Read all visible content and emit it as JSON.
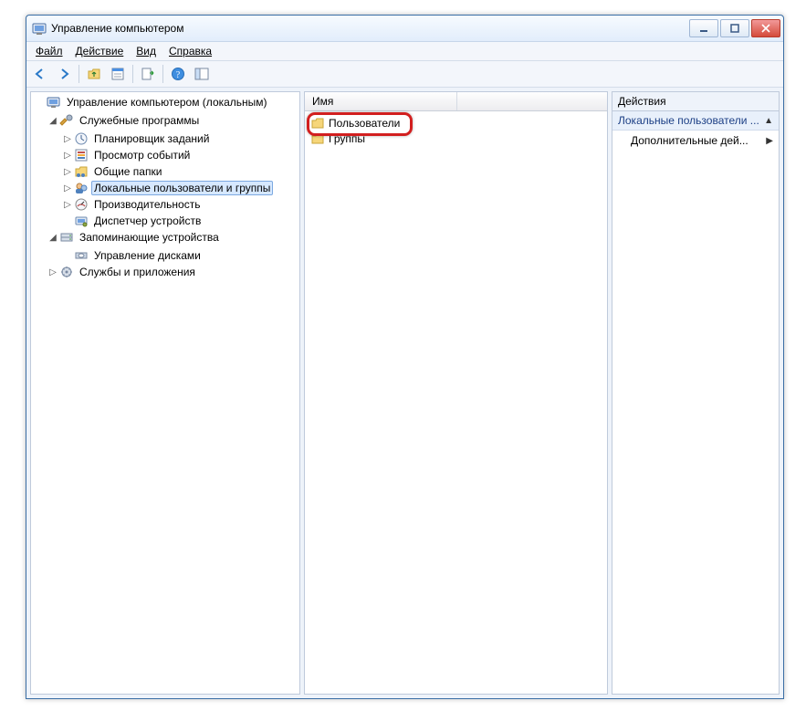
{
  "window": {
    "title": "Управление компьютером"
  },
  "menu": {
    "file": "Файл",
    "action": "Действие",
    "view": "Вид",
    "help": "Справка"
  },
  "toolbar": {
    "back": "back",
    "forward": "forward",
    "up": "up-folder",
    "properties": "properties",
    "export": "export-list",
    "help": "help",
    "show_hide": "show-hide-console"
  },
  "tree": {
    "root": "Управление компьютером (локальным)",
    "utilities": "Служебные программы",
    "utilities_children": {
      "task_scheduler": "Планировщик заданий",
      "event_viewer": "Просмотр событий",
      "shared_folders": "Общие папки",
      "local_users_groups": "Локальные пользователи и группы",
      "performance": "Производительность",
      "device_manager": "Диспетчер устройств"
    },
    "storage": "Запоминающие устройства",
    "storage_children": {
      "disk_mgmt": "Управление дисками"
    },
    "services_apps": "Службы и приложения"
  },
  "list": {
    "header_name": "Имя",
    "rows": [
      {
        "label": "Пользователи"
      },
      {
        "label": "Группы"
      }
    ]
  },
  "actions": {
    "header": "Действия",
    "section": "Локальные пользователи ...",
    "more": "Дополнительные дей..."
  }
}
